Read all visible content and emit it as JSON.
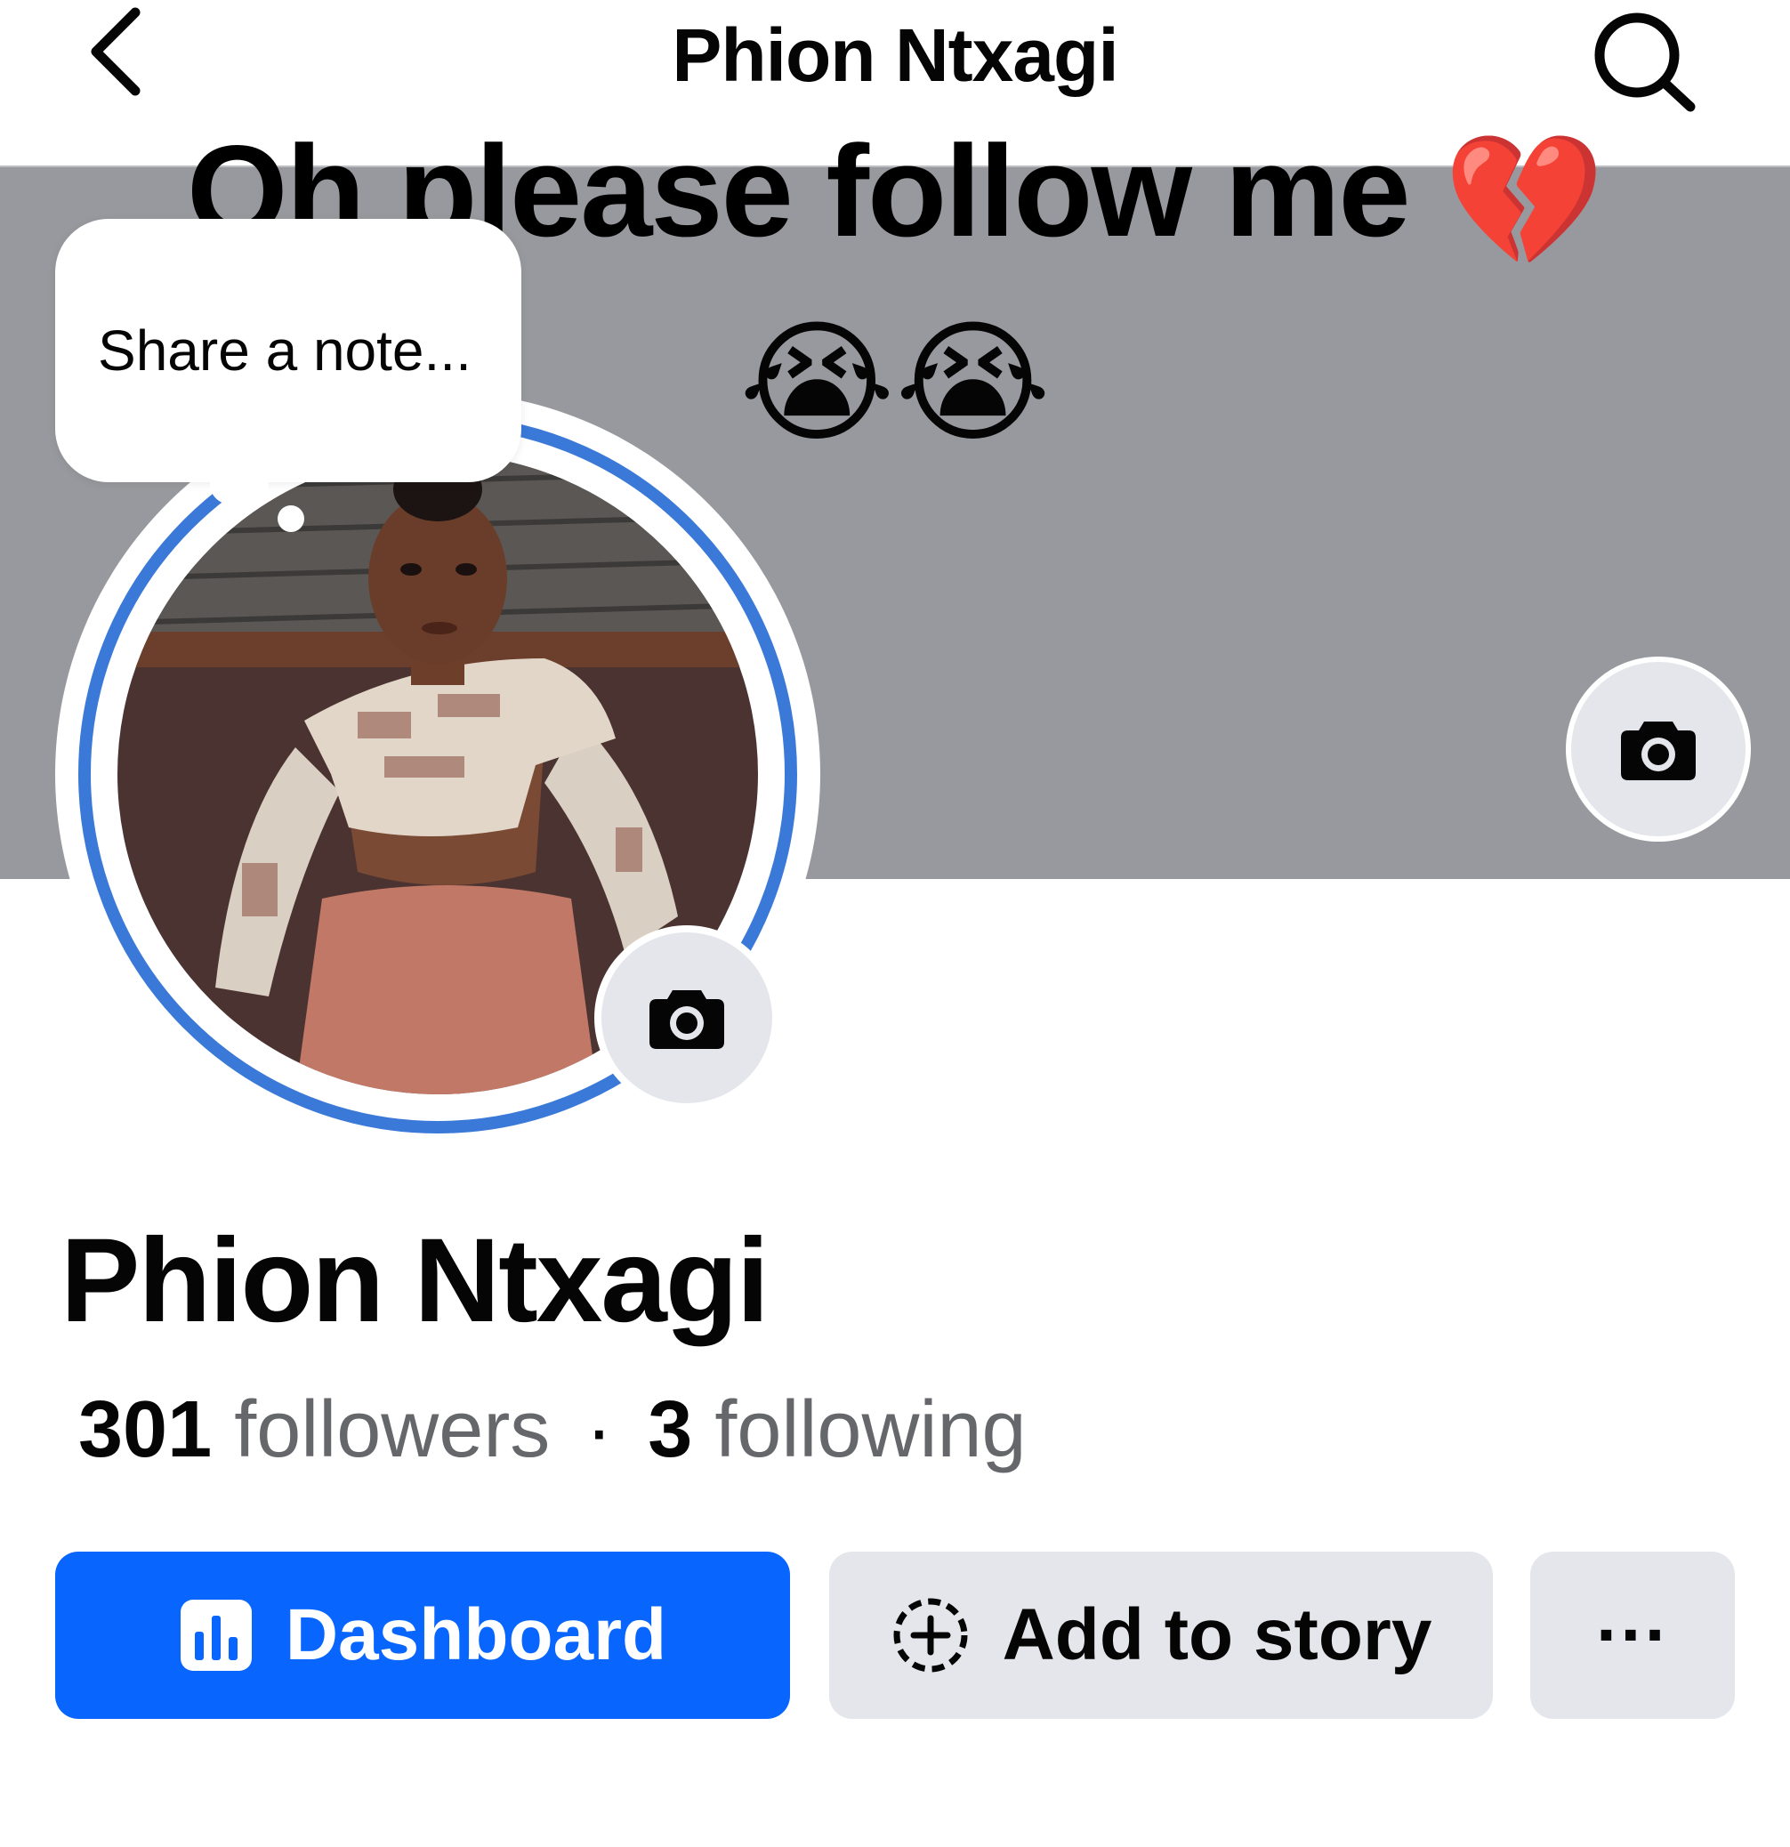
{
  "header": {
    "title": "Phion Ntxagi",
    "back_icon": "chevron-left-icon",
    "search_icon": "search-icon"
  },
  "cover": {
    "caption_text": "Oh please follow me",
    "caption_emoji_1": "💔",
    "caption_emoji_2": "😭😭",
    "background_color": "#98999e",
    "camera_icon": "camera-icon"
  },
  "note": {
    "placeholder": "Share a note..."
  },
  "profile": {
    "name": "Phion Ntxagi",
    "ring_color": "#3a79d8",
    "camera_icon": "camera-icon"
  },
  "stats": {
    "followers_count": "301",
    "followers_label": "followers",
    "separator": "·",
    "following_count": "3",
    "following_label": "following"
  },
  "actions": {
    "dashboard_label": "Dashboard",
    "dashboard_icon": "bar-chart-icon",
    "add_story_label": "Add to story",
    "add_story_icon": "plus-circle-icon",
    "more_label": "···",
    "primary_color": "#0866ff",
    "secondary_color": "#e4e6eb"
  }
}
